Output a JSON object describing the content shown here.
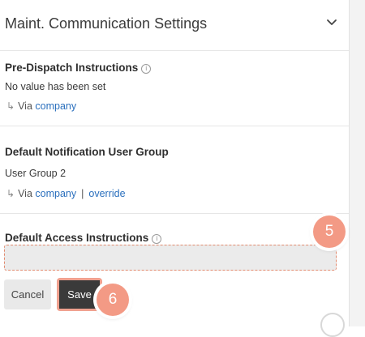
{
  "header": {
    "title": "Maint. Communication Settings"
  },
  "sections": {
    "pre_dispatch": {
      "label": "Pre-Dispatch Instructions",
      "value": "No value has been set",
      "via_text": "Via",
      "via_link": "company"
    },
    "notification_group": {
      "label": "Default Notification User Group",
      "value": "User Group 2",
      "via_text": "Via",
      "via_link": "company",
      "separator": "|",
      "override_link": "override"
    },
    "access": {
      "label": "Default Access Instructions",
      "input_value": ""
    }
  },
  "buttons": {
    "cancel": "Cancel",
    "save": "Save"
  },
  "badges": {
    "b5": "5",
    "b6": "6"
  },
  "icons": {
    "info": "ⓘ",
    "chevron": "chevron-down-icon",
    "via_arrow": "↳"
  },
  "colors": {
    "link": "#2a6fbd",
    "badge": "#f39a85",
    "save_bg": "#3a3a3a",
    "highlight_border": "#e28b6f"
  }
}
